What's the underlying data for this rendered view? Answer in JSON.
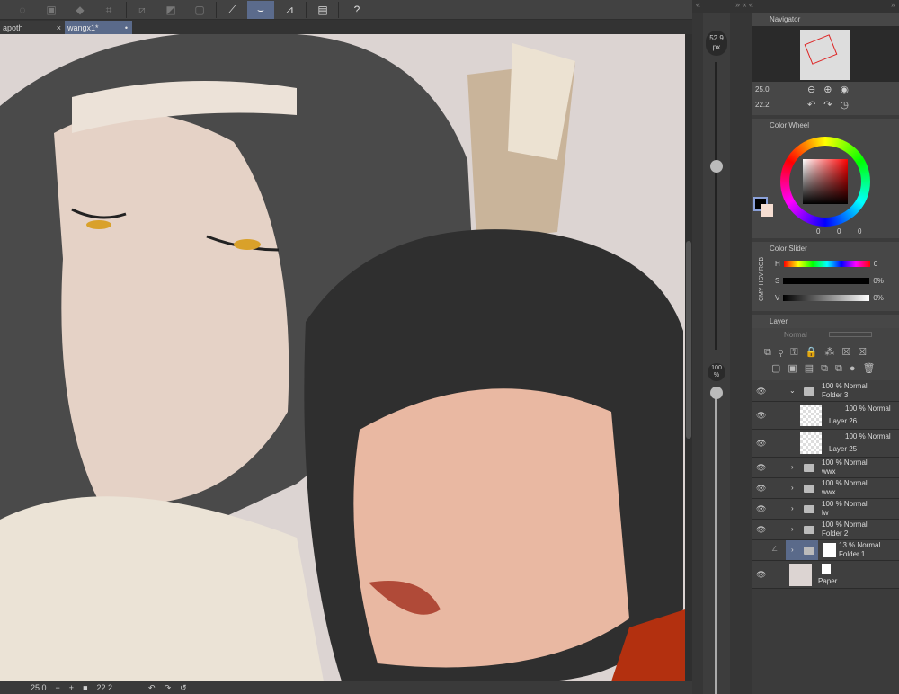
{
  "toolbar": {
    "icons": [
      "lasso-icon",
      "select-icon",
      "fill-icon",
      "crop-icon",
      "clear-icon",
      "invert-icon",
      "frame-icon",
      "pen-tool-icon",
      "brush-tool-icon",
      "ruler-tool-icon",
      "layer-property-icon",
      "help-icon"
    ],
    "selected": "brush-tool-icon"
  },
  "tabs": [
    {
      "label": "apoth",
      "close": "×"
    },
    {
      "label": "wangx1*",
      "close": "•",
      "active": true
    }
  ],
  "bottom": {
    "zoom": "25.0",
    "minus": "−",
    "plus": "+",
    "rotation": "22.2"
  },
  "brush": {
    "size": "52.9",
    "unit": "px",
    "opacity": "100",
    "opacity_unit": "%"
  },
  "navigator": {
    "title": "Navigator",
    "zoom": "25.0",
    "rotation": "22.2"
  },
  "color_wheel": {
    "title": "Color Wheel",
    "values": [
      "0",
      "0",
      "0"
    ],
    "main_color": "#000000",
    "sub_color": "#f6ded2"
  },
  "color_slider": {
    "title": "Color Slider",
    "modes": [
      "RGB",
      "HSV",
      "CMY"
    ],
    "rows": [
      {
        "label": "H",
        "value": "0"
      },
      {
        "label": "S",
        "value": "0%"
      },
      {
        "label": "V",
        "value": "0%"
      }
    ]
  },
  "layer_panel": {
    "title": "Layer",
    "blend_mode": "Normal",
    "layers": [
      {
        "mode": "100 % Normal",
        "name": "Folder 3",
        "type": "folder",
        "expanded": true
      },
      {
        "mode": "100 % Normal",
        "name": "Layer 26",
        "type": "raster"
      },
      {
        "mode": "100 % Normal",
        "name": "Layer 25",
        "type": "raster"
      },
      {
        "mode": "100 % Normal",
        "name": "wwx",
        "type": "folder"
      },
      {
        "mode": "100 % Normal",
        "name": "wwx",
        "type": "folder"
      },
      {
        "mode": "100 % Normal",
        "name": "lw",
        "type": "folder"
      },
      {
        "mode": "100 % Normal",
        "name": "Folder 2",
        "type": "folder"
      },
      {
        "mode": "13 % Normal",
        "name": "Folder 1",
        "type": "folder",
        "selected": true
      },
      {
        "mode": "",
        "name": "Paper",
        "type": "paper"
      }
    ]
  }
}
